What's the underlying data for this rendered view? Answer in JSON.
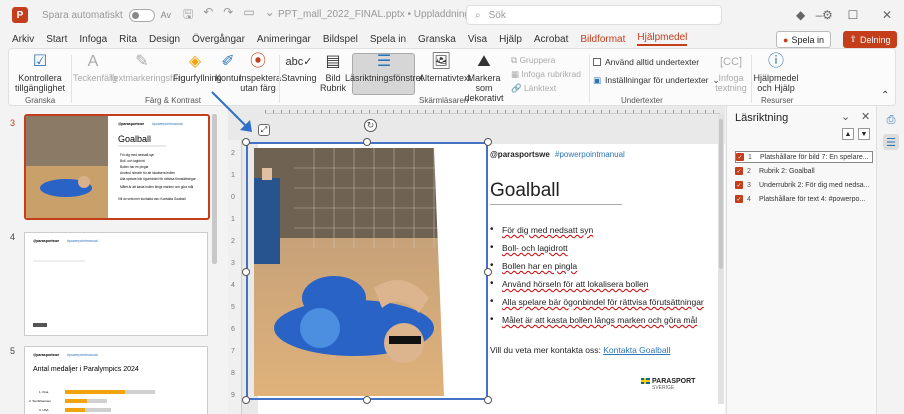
{
  "titlebar": {
    "app_logo": "P",
    "autosave_label": "Spara automatiskt",
    "autosave_state": "Av",
    "doc_title": "PPT_mall_2022_FINAL.pptx • Uppladdning blockerad",
    "search_placeholder": "Sök",
    "qat_icons": [
      "save-icon",
      "undo-icon",
      "redo-icon",
      "present-icon",
      "more-icon"
    ]
  },
  "menu": {
    "tabs": [
      "Arkiv",
      "Start",
      "Infoga",
      "Rita",
      "Design",
      "Övergångar",
      "Animeringar",
      "Bildspel",
      "Spela in",
      "Granska",
      "Visa",
      "Hjälp",
      "Acrobat",
      "Bildformat",
      "Hjälpmedel"
    ],
    "colored_tab": "Bildformat",
    "active_tab": "Hjälpmedel",
    "record_button": "Spela in",
    "share_button": "Delning"
  },
  "ribbon": {
    "check": {
      "label": "Kontrollera tillgänglighet",
      "group": "Granska"
    },
    "color_group": {
      "group": "Färg & Kontrast",
      "buttons": [
        "Teckenfärg",
        "Textmarkeringsfärg",
        "Figurfyllning",
        "Kontur",
        "Inspektera utan färg"
      ]
    },
    "screenreader_group": {
      "group": "Skärmläsaren",
      "buttons": [
        "Stavning",
        "Bild Rubrik",
        "Läsriktningsfönstret",
        "Alternativtext",
        "Markera som dekorativt"
      ],
      "small": [
        "Gruppera",
        "Infoga rubrikrad",
        "Länktext"
      ]
    },
    "captions_group": {
      "group": "Undertexter",
      "always_captions": "Använd alltid undertexter",
      "caption_settings": "Inställningar för undertexter",
      "insert_captions": "Infoga textning"
    },
    "resources_group": {
      "group": "Resurser",
      "help": "Hjälpmedel och Hjälp"
    }
  },
  "thumbnails": {
    "numbers": [
      "3",
      "4",
      "5"
    ],
    "slide3": {
      "brand": "@parasportswe",
      "hashtag": "#powerpointmanual",
      "title": "Goalball",
      "lines": [
        "För dig med nedsatt syn",
        "Boll- och lagidrott",
        "Bollen har en pingla",
        "Använd hörseln för att lokalisera bollen",
        "Alla spelare bär ögonbindel för rättvisa förutsättningar",
        "Målet är att kasta bollen längs marken och göra mål"
      ],
      "contact": "Vill du veta mer kontakta oss: Kontakta Goalball"
    },
    "slide4": {
      "brand": "@parasportswe",
      "hashtag": "#powerpointmanual"
    },
    "slide5": {
      "brand": "@parasportswe",
      "hashtag": "#powerpointmanual",
      "title": "Antal medaljer i Paralympics 2024",
      "rows": [
        "1. Kina",
        "2. Storbritannien",
        "3. USA"
      ]
    }
  },
  "slide": {
    "brand": "@parasportswe",
    "hashtag": "#powerpointmanual",
    "title": "Goalball",
    "bullets": [
      "För dig med nedsatt syn",
      "Boll- och lagidrott",
      "Bollen har en pingla",
      "Använd hörseln för att lokalisera bollen",
      "Alla spelare bär ögonbindel för rättvisa förutsättningar",
      "Målet är att kasta bollen längs marken och göra mål"
    ],
    "contact_prefix": "Vill du veta mer kontakta oss:",
    "contact_link": "Kontakta Goalball",
    "logo_text": "PARASPORT",
    "logo_sub": "SVERIGE",
    "ruler_numbers": [
      "2",
      "1",
      "0",
      "1",
      "2",
      "3",
      "4",
      "5",
      "6",
      "7",
      "8",
      "9"
    ]
  },
  "reading_pane": {
    "title": "Läsriktning",
    "items": [
      {
        "num": "1",
        "label": "Platshållare för bild 7: En spelare..."
      },
      {
        "num": "2",
        "label": "Rubrik 2: Goalball"
      },
      {
        "num": "3",
        "label": "Underrubrik 2: För dig med nedsa..."
      },
      {
        "num": "4",
        "label": "Platshållare för text 4: #powerpo..."
      }
    ],
    "selected_index": 0
  },
  "colors": {
    "accent": "#c43e1c",
    "selection_blue": "#4472c4",
    "link_blue": "#2e75b6",
    "court_yellow": "#e8b96a",
    "jersey_blue": "#2a63c6"
  }
}
